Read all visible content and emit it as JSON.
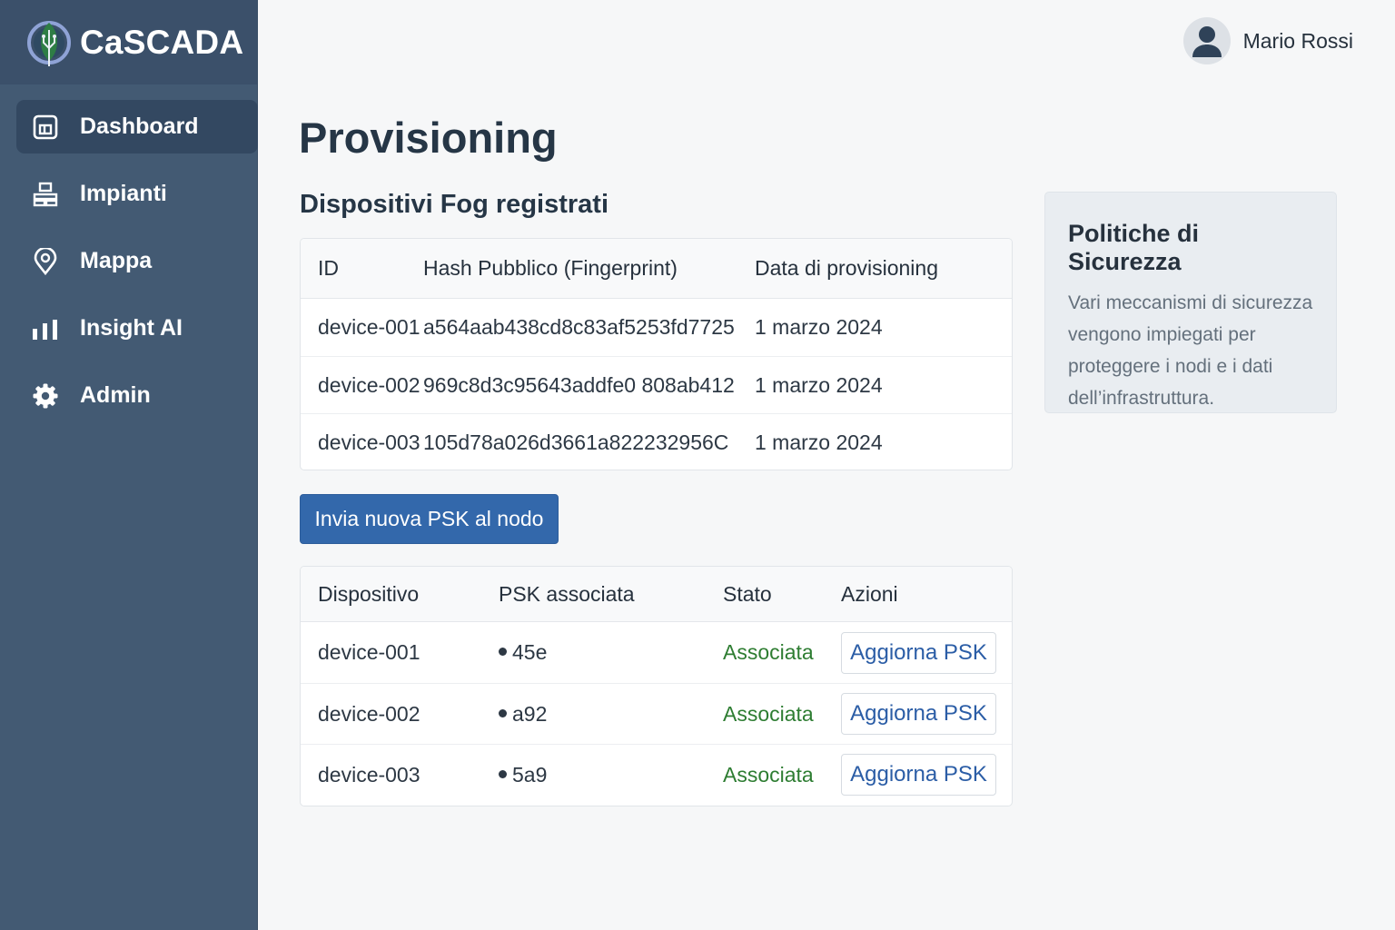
{
  "brand": {
    "name": "CaSCADA",
    "logo_icon": "leaf-circuit-icon"
  },
  "sidebar": {
    "items": [
      {
        "label": "Dashboard",
        "icon": "dashboard-icon",
        "active": true
      },
      {
        "label": "Impianti",
        "icon": "plants-icon",
        "active": false
      },
      {
        "label": "Mappa",
        "icon": "map-pin-icon",
        "active": false
      },
      {
        "label": "Insight AI",
        "icon": "bar-chart-icon",
        "active": false
      },
      {
        "label": "Admin",
        "icon": "gear-icon",
        "active": false
      }
    ]
  },
  "header": {
    "user_name": "Mario Rossi",
    "avatar_icon": "user-avatar-icon"
  },
  "main": {
    "title": "Provisioning",
    "fog_section_title": "Dispositivi Fog registrati",
    "fog_table": {
      "headers": [
        "ID",
        "Hash Pubblico (Fingerprint)",
        "Data di provisioning"
      ],
      "rows": [
        {
          "id": "device-001",
          "hash": "a564aab438cd8c83af5253fd7725",
          "date": "1 marzo 2024"
        },
        {
          "id": "device-002",
          "hash": "969c8d3c95643addfe0 808ab412",
          "date": "1 marzo 2024"
        },
        {
          "id": "device-003",
          "hash": "105d78a026d3661a822232956C",
          "date": "1 marzo 2024"
        }
      ]
    },
    "send_psk_button": "Invia nuova PSK al nodo",
    "psk_table": {
      "headers": [
        "Dispositivo",
        "PSK associata",
        "Stato",
        "Azioni"
      ],
      "rows": [
        {
          "device": "device-001",
          "psk": "45e",
          "status": "Associata",
          "action": "Aggiorna PSK"
        },
        {
          "device": "device-002",
          "psk": "a92",
          "status": "Associata",
          "action": "Aggiorna PSK"
        },
        {
          "device": "device-003",
          "psk": "5a9",
          "status": "Associata",
          "action": "Aggiorna PSK"
        }
      ]
    }
  },
  "policy_card": {
    "title": "Politiche di Sicurezza",
    "text": "Vari meccanismi di sicurezza vengono impiegati per proteggere i nodi e i dati dell’infrastruttura."
  },
  "colors": {
    "sidebar": "#435a73",
    "sidebar_active": "#334861",
    "primary": "#3368ab",
    "status_ok": "#2e7d32",
    "link": "#2b5da6"
  }
}
